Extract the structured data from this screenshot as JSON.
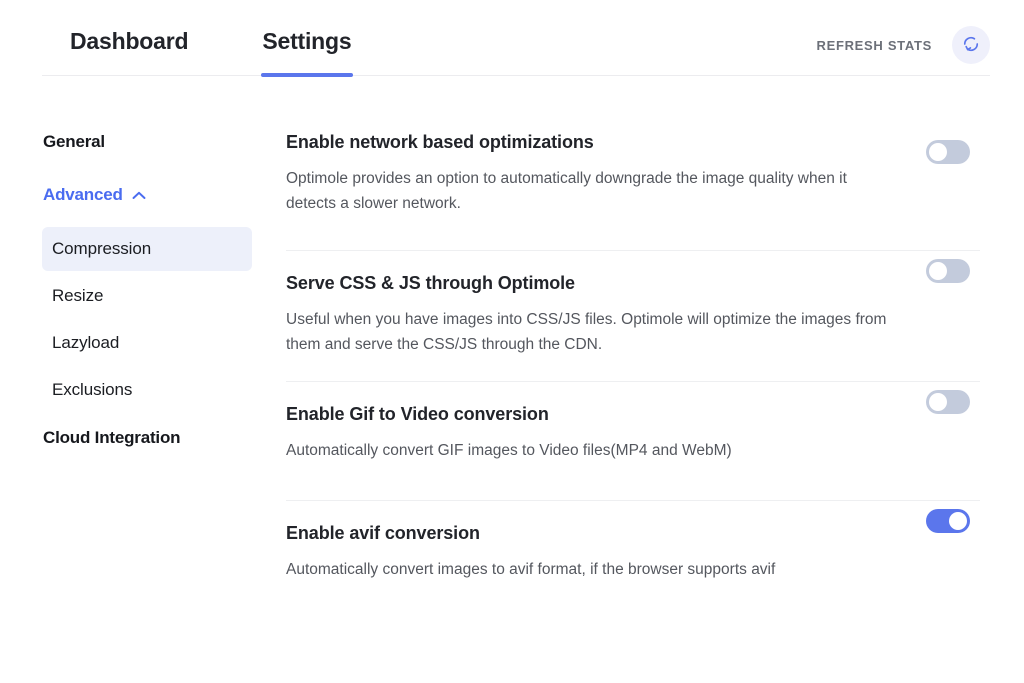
{
  "header": {
    "tabs": [
      {
        "label": "Dashboard",
        "active": false
      },
      {
        "label": "Settings",
        "active": true
      }
    ],
    "refresh_label": "REFRESH STATS",
    "refresh_icon": "refresh-icon"
  },
  "sidebar": {
    "general_label": "General",
    "advanced_label": "Advanced",
    "advanced_chevron": "chevron-up-icon",
    "sub_items": [
      {
        "label": "Compression",
        "selected": true
      },
      {
        "label": "Resize",
        "selected": false
      },
      {
        "label": "Lazyload",
        "selected": false
      },
      {
        "label": "Exclusions",
        "selected": false
      }
    ],
    "cloud_label": "Cloud Integration"
  },
  "settings": [
    {
      "title": "Enable network based optimizations",
      "description": "Optimole provides an option to automatically downgrade the image quality when it detects a slower network.",
      "enabled": false
    },
    {
      "title": "Serve CSS & JS through Optimole",
      "description": "Useful when you have images into CSS/JS files. Optimole will optimize the images from them and serve the CSS/JS through the CDN.",
      "enabled": false
    },
    {
      "title": "Enable Gif to Video conversion",
      "description": "Automatically convert GIF images to Video files(MP4 and WebM)",
      "enabled": false
    },
    {
      "title": "Enable avif conversion",
      "description": "Automatically convert images to avif format, if the browser supports avif",
      "enabled": true
    }
  ],
  "colors": {
    "accent": "#5b76ec",
    "accent_link": "#4a6cf0",
    "toggle_off": "#c3cbdc",
    "selected_bg": "#edf0fa",
    "refresh_bg": "#eff0fb",
    "text_dark": "#22242a",
    "text_body": "#54575e"
  }
}
